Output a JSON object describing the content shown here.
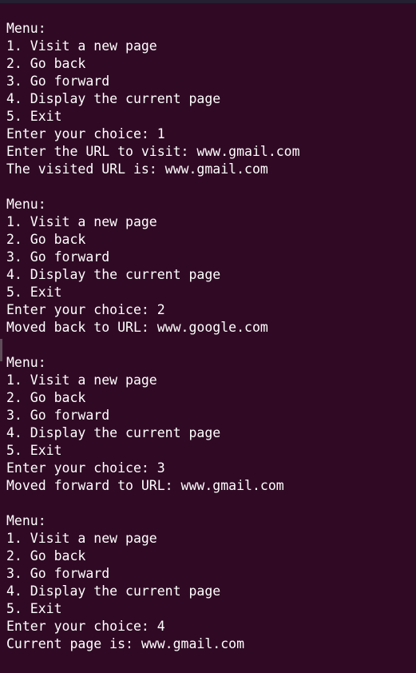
{
  "terminal": {
    "lines": [
      "Menu:",
      "1. Visit a new page",
      "2. Go back",
      "3. Go forward",
      "4. Display the current page",
      "5. Exit",
      "Enter your choice: 1",
      "Enter the URL to visit: www.gmail.com",
      "The visited URL is: www.gmail.com",
      "",
      "Menu:",
      "1. Visit a new page",
      "2. Go back",
      "3. Go forward",
      "4. Display the current page",
      "5. Exit",
      "Enter your choice: 2",
      "Moved back to URL: www.google.com",
      "",
      "Menu:",
      "1. Visit a new page",
      "2. Go back",
      "3. Go forward",
      "4. Display the current page",
      "5. Exit",
      "Enter your choice: 3",
      "Moved forward to URL: www.gmail.com",
      "",
      "Menu:",
      "1. Visit a new page",
      "2. Go back",
      "3. Go forward",
      "4. Display the current page",
      "5. Exit",
      "Enter your choice: 4",
      "Current page is: www.gmail.com"
    ]
  },
  "colors": {
    "background": "#300a24",
    "text": "#ffffff"
  }
}
